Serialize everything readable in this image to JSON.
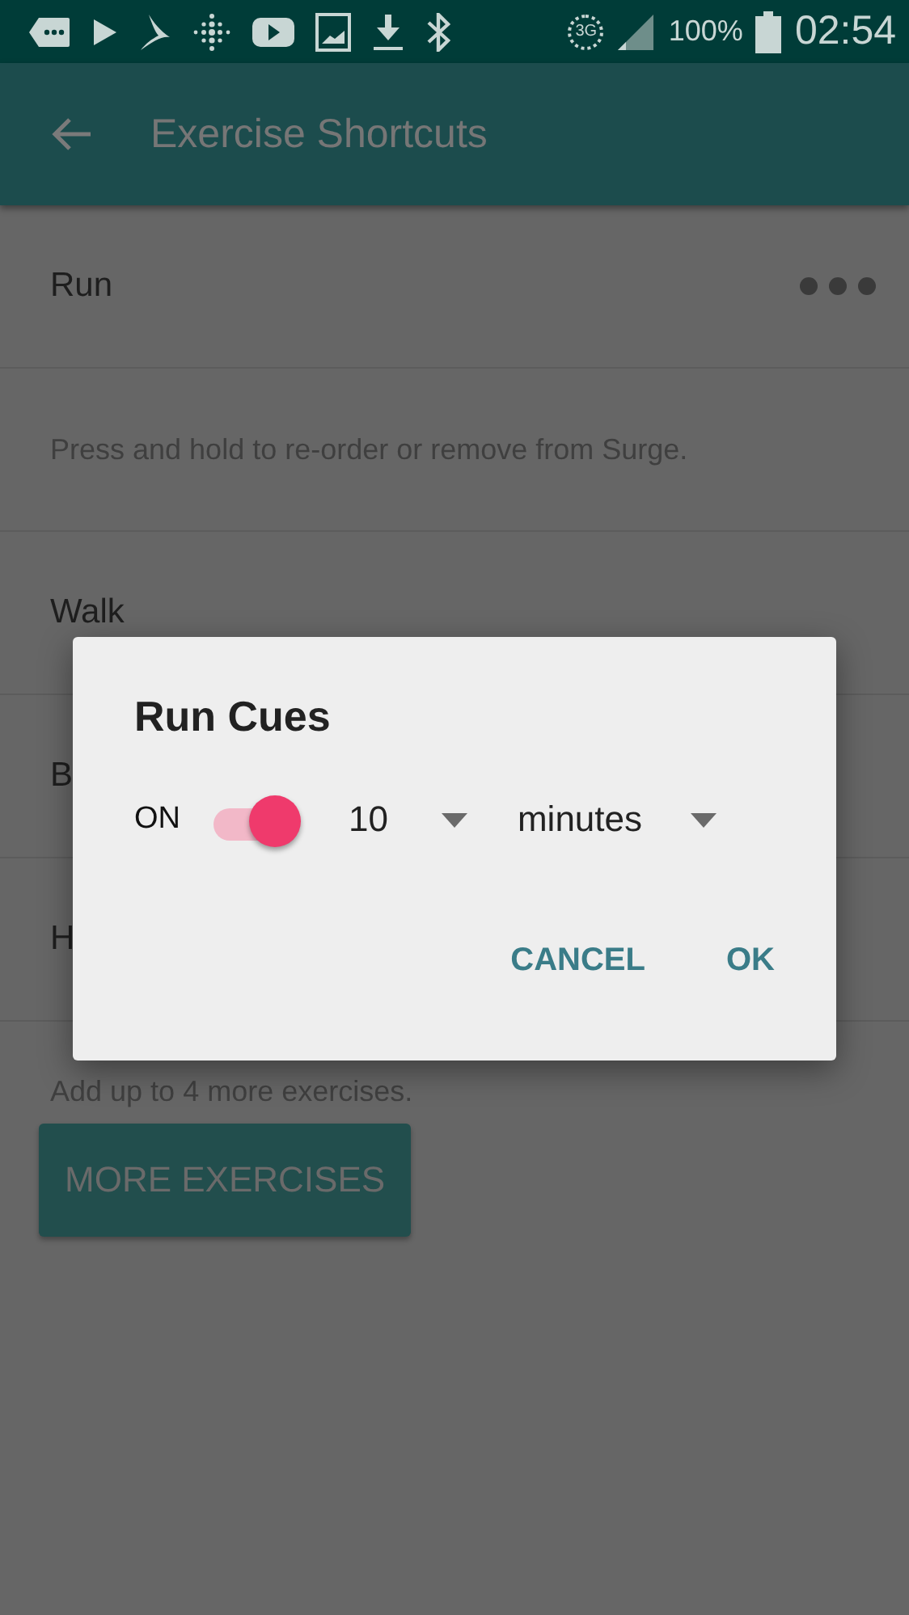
{
  "status_bar": {
    "network": "3G",
    "battery": "100%",
    "time": "02:54"
  },
  "app_bar": {
    "title": "Exercise Shortcuts"
  },
  "list": [
    {
      "kind": "exercise",
      "label": "Run",
      "more": true
    },
    {
      "kind": "hint",
      "label": "Press and hold to re-order or remove from Surge."
    },
    {
      "kind": "exercise",
      "label": "Walk",
      "more": false
    },
    {
      "kind": "exercise",
      "label": "B",
      "more": false
    },
    {
      "kind": "exercise",
      "label": "H",
      "more": false
    }
  ],
  "footer": {
    "note": "Add up to 4 more exercises.",
    "button": "MORE EXERCISES"
  },
  "dialog": {
    "title": "Run Cues",
    "switch": {
      "label": "ON",
      "on": true
    },
    "interval": "10",
    "unit": "minutes",
    "buttons": [
      "CANCEL",
      "OK"
    ]
  }
}
